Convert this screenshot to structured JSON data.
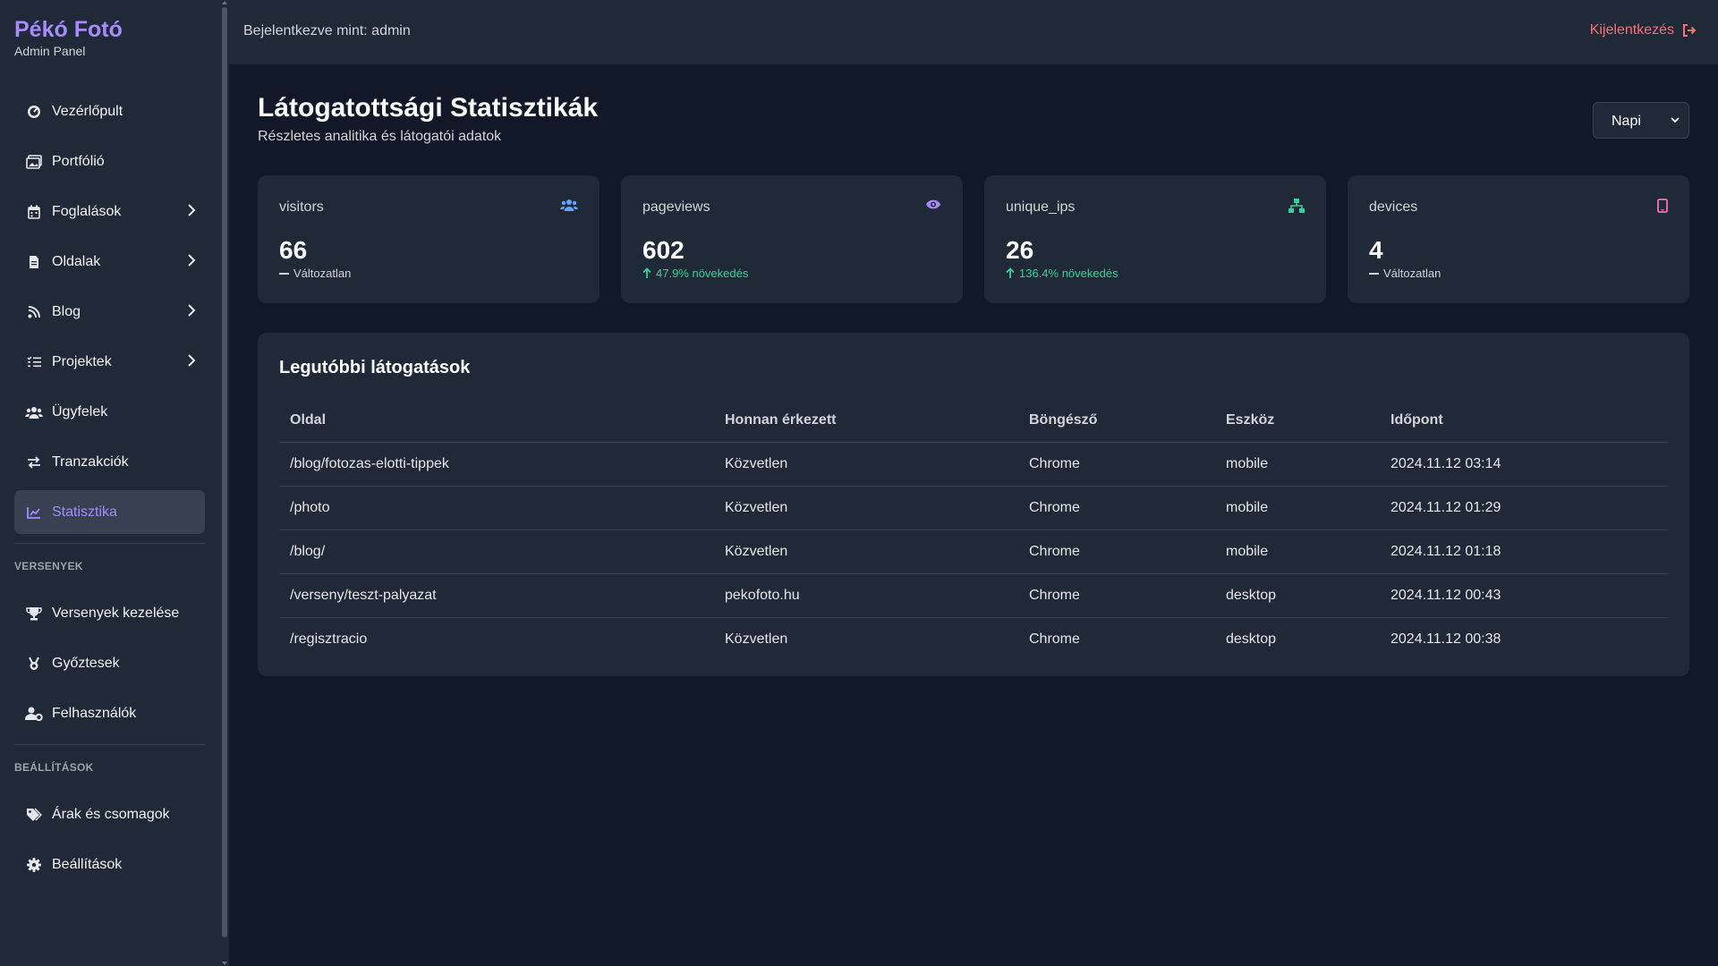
{
  "brand": {
    "title": "Pékó Fotó",
    "subtitle": "Admin Panel"
  },
  "sidebar": {
    "items": [
      {
        "label": "Vezérlőpult",
        "icon": "dashboard-icon"
      },
      {
        "label": "Portfólió",
        "icon": "images-icon"
      },
      {
        "label": "Foglalások",
        "icon": "calendar-icon",
        "expandable": true
      },
      {
        "label": "Oldalak",
        "icon": "file-icon",
        "expandable": true
      },
      {
        "label": "Blog",
        "icon": "blog-icon",
        "expandable": true
      },
      {
        "label": "Projektek",
        "icon": "list-icon",
        "expandable": true
      },
      {
        "label": "Ügyfelek",
        "icon": "users-icon"
      },
      {
        "label": "Tranzakciók",
        "icon": "exchange-icon"
      },
      {
        "label": "Statisztika",
        "icon": "chart-line-icon",
        "active": true
      }
    ],
    "sections": [
      {
        "title": "VERSENYEK",
        "items": [
          {
            "label": "Versenyek kezelése",
            "icon": "trophy-icon"
          },
          {
            "label": "Győztesek",
            "icon": "medal-icon"
          },
          {
            "label": "Felhasználók",
            "icon": "user-gear-icon"
          }
        ]
      },
      {
        "title": "BEÁLLÍTÁSOK",
        "items": [
          {
            "label": "Árak és csomagok",
            "icon": "tags-icon"
          },
          {
            "label": "Beállítások",
            "icon": "gear-icon"
          }
        ]
      }
    ]
  },
  "topbar": {
    "logged_in": "Bejelentkezve mint: admin",
    "logout": "Kijelentkezés"
  },
  "page": {
    "title": "Látogatottsági Statisztikák",
    "subtitle": "Részletes analitika és látogatói adatok",
    "period": "Napi"
  },
  "cards": [
    {
      "label": "visitors",
      "value": "66",
      "change": "Változatlan",
      "trend": "neutral",
      "icon": "users-icon",
      "color": "#60a5fa"
    },
    {
      "label": "pageviews",
      "value": "602",
      "change": "47.9% növekedés",
      "trend": "up",
      "icon": "eye-icon",
      "color": "#a78bfa"
    },
    {
      "label": "unique_ips",
      "value": "26",
      "change": "136.4% növekedés",
      "trend": "up",
      "icon": "network-icon",
      "color": "#34d399"
    },
    {
      "label": "devices",
      "value": "4",
      "change": "Változatlan",
      "trend": "neutral",
      "icon": "mobile-icon",
      "color": "#f472b6"
    }
  ],
  "recent": {
    "title": "Legutóbbi látogatások",
    "columns": [
      "Oldal",
      "Honnan érkezett",
      "Böngésző",
      "Eszköz",
      "Időpont"
    ],
    "rows": [
      [
        "/blog/fotozas-elotti-tippek",
        "Közvetlen",
        "Chrome",
        "mobile",
        "2024.11.12 03:14"
      ],
      [
        "/photo",
        "Közvetlen",
        "Chrome",
        "mobile",
        "2024.11.12 01:29"
      ],
      [
        "/blog/",
        "Közvetlen",
        "Chrome",
        "mobile",
        "2024.11.12 01:18"
      ],
      [
        "/verseny/teszt-palyazat",
        "pekofoto.hu",
        "Chrome",
        "desktop",
        "2024.11.12 00:43"
      ],
      [
        "/regisztracio",
        "Közvetlen",
        "Chrome",
        "desktop",
        "2024.11.12 00:38"
      ]
    ]
  }
}
